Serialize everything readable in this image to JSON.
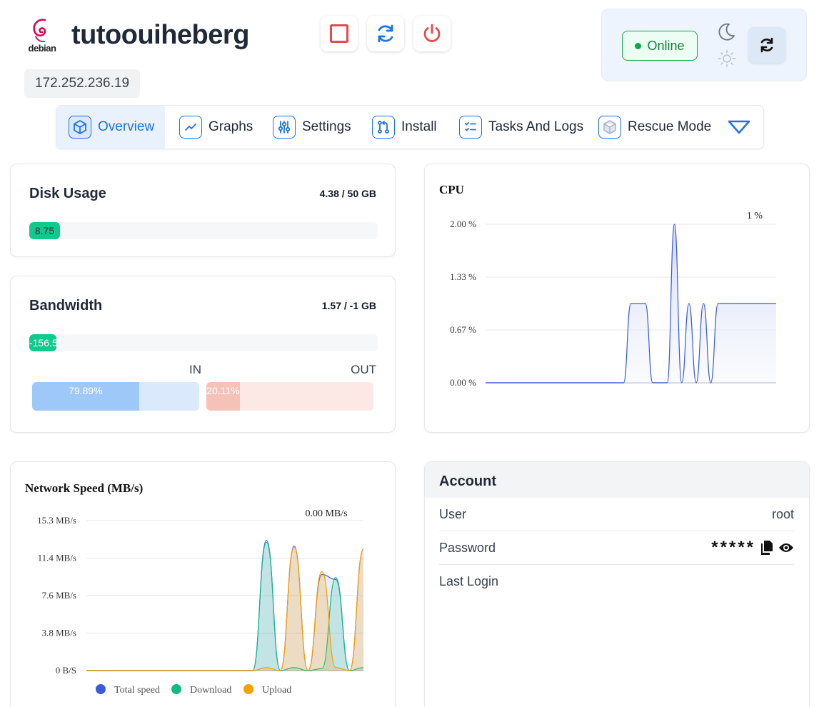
{
  "header": {
    "os_label": "debian",
    "hostname": "tutoouiheberg",
    "ip": "172.252.236.19"
  },
  "controls": {
    "status": "Online",
    "colors": {
      "stop": "#e5484d",
      "restart": "#1a73e8",
      "power": "#e5484d",
      "online": "#16a34a"
    }
  },
  "tabs": [
    {
      "label": "Overview",
      "icon": "cube-icon",
      "active": true
    },
    {
      "label": "Graphs",
      "icon": "chart-line-icon"
    },
    {
      "label": "Settings",
      "icon": "sliders-icon"
    },
    {
      "label": "Install",
      "icon": "git-pull-icon"
    },
    {
      "label": "Tasks And Logs",
      "icon": "tasks-icon"
    },
    {
      "label": "Rescue Mode",
      "icon": "rescue-cube-icon"
    }
  ],
  "disk": {
    "title": "Disk Usage",
    "value": "4.38 / 50 GB",
    "bar_label": "8.75",
    "percent": 8.75
  },
  "bandwidth": {
    "title": "Bandwidth",
    "value": "1.57 / -1 GB",
    "bar_label": "-156.5",
    "in_label": "IN",
    "out_label": "OUT",
    "in_percent_label": "79.89%",
    "out_percent_label": "20.11%",
    "in_percent": 79.89,
    "out_percent": 20.11
  },
  "cpu_chart": {
    "title": "CPU",
    "current_label": "1 %",
    "ticks": [
      "2.00 %",
      "1.33 %",
      "0.67 %",
      "0.00 %"
    ]
  },
  "network_chart": {
    "title": "Network Speed (MB/s)",
    "current_label": "0.00 MB/s",
    "ticks": [
      "15.3 MB/s",
      "11.4 MB/s",
      "7.6 MB/s",
      "3.8 MB/s",
      "0 B/S"
    ],
    "legend": [
      {
        "name": "Total speed",
        "color": "#3b5bdb"
      },
      {
        "name": "Download",
        "color": "#12b886"
      },
      {
        "name": "Upload",
        "color": "#f59f00"
      }
    ]
  },
  "account": {
    "title": "Account",
    "user_label": "User",
    "user_value": "root",
    "password_label": "Password",
    "password_mask": "*****",
    "last_login_label": "Last Login"
  },
  "chart_data": [
    {
      "type": "area",
      "title": "CPU",
      "ylabel": "",
      "ylim": [
        0,
        2
      ],
      "x": [
        0,
        1,
        2,
        3,
        4,
        5,
        6,
        7,
        8,
        9,
        10,
        11,
        12,
        13,
        14,
        15,
        16,
        17,
        18,
        19,
        20,
        21,
        22,
        23,
        24,
        25,
        26,
        27,
        28,
        29,
        30,
        31,
        32,
        33,
        34,
        35,
        36,
        37,
        38,
        39,
        40
      ],
      "series": [
        {
          "values": [
            0,
            0,
            0,
            0,
            0,
            0,
            0,
            0,
            0,
            0,
            0,
            0,
            0,
            0,
            0,
            0,
            0,
            0,
            0,
            0,
            1,
            1,
            1,
            0,
            0,
            0,
            2,
            0,
            1,
            0,
            1,
            0,
            1,
            1,
            1,
            1,
            1,
            1,
            1,
            1,
            1
          ]
        }
      ]
    },
    {
      "type": "area",
      "title": "Network Speed (MB/s)",
      "ylim": [
        0,
        15.3
      ],
      "x": [
        0,
        1,
        2,
        3,
        4,
        5,
        6,
        7,
        8,
        9,
        10,
        11,
        12,
        13,
        14,
        15,
        16,
        17,
        18,
        19,
        20
      ],
      "series": [
        {
          "name": "Total speed",
          "values": [
            0,
            0,
            0,
            0,
            0,
            0,
            0,
            0,
            0,
            0,
            0,
            0,
            0,
            13.3,
            0,
            12.7,
            0,
            9.8,
            9.3,
            0,
            12.4
          ]
        },
        {
          "name": "Download",
          "values": [
            0,
            0,
            0,
            0,
            0,
            0,
            0,
            0,
            0,
            0,
            0,
            0,
            0,
            13.1,
            0,
            0.3,
            0,
            0.2,
            9.5,
            0,
            0.3
          ]
        },
        {
          "name": "Upload",
          "values": [
            0,
            0,
            0,
            0,
            0,
            0,
            0,
            0,
            0,
            0,
            0,
            0,
            0,
            0.3,
            0,
            12.6,
            0,
            10.1,
            0.3,
            0,
            12.4
          ]
        }
      ]
    }
  ]
}
